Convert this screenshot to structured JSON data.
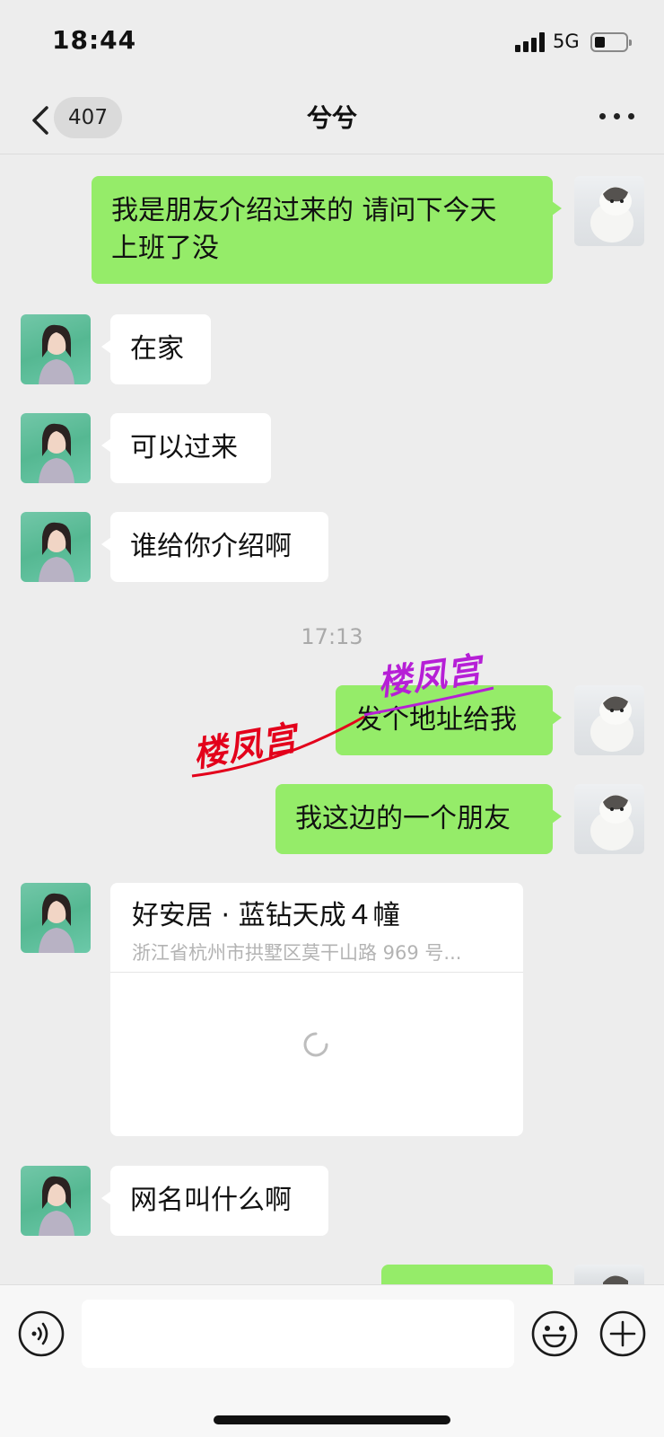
{
  "status_bar": {
    "time": "18:44",
    "network": "5G"
  },
  "nav": {
    "unread_count": "407",
    "title": "兮兮"
  },
  "messages": [
    {
      "text": "我是朋友介绍过来的 请问下今天\n上班了没"
    },
    {
      "text": "在家"
    },
    {
      "text": "可以过来"
    },
    {
      "text": "谁给你介绍啊"
    },
    {
      "text": "发个地址给我"
    },
    {
      "text": "我这边的一个朋友"
    },
    {
      "text": "网名叫什么啊"
    }
  ],
  "timestamp": "17:13",
  "location_card": {
    "title": "好安居 · 蓝钻天成４幢",
    "address": "浙江省杭州市拱墅区莫干山路 969 号..."
  },
  "watermarks": [
    "楼凤宫",
    "楼凤宫"
  ],
  "input": {
    "value": ""
  },
  "colors": {
    "outgoing_bubble": "#95ec69",
    "incoming_bubble": "#ffffff",
    "background": "#ededed",
    "watermark_red": "#e3001b",
    "watermark_purple": "#b61fd6"
  },
  "icons": {
    "back": "chevron-left-icon",
    "more": "more-dots-icon",
    "voice": "voice-icon",
    "emoji": "emoji-icon",
    "plus": "plus-circle-icon"
  }
}
